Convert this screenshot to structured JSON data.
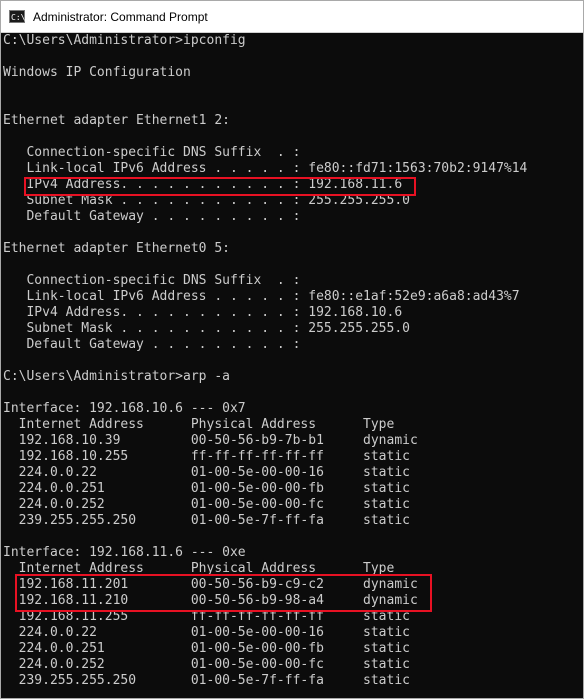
{
  "window": {
    "title": "Administrator: Command Prompt",
    "icon": "command-prompt-icon",
    "icon_glyph": "C:\\",
    "highlight_color": "#e81123"
  },
  "console": {
    "lines": [
      "C:\\Users\\Administrator>ipconfig",
      "",
      "Windows IP Configuration",
      "",
      "",
      "Ethernet adapter Ethernet1 2:",
      "",
      "   Connection-specific DNS Suffix  . :",
      "   Link-local IPv6 Address . . . . . : fe80::fd71:1563:70b2:9147%14",
      "   IPv4 Address. . . . . . . . . . . : 192.168.11.6",
      "   Subnet Mask . . . . . . . . . . . : 255.255.255.0",
      "   Default Gateway . . . . . . . . . :",
      "",
      "Ethernet adapter Ethernet0 5:",
      "",
      "   Connection-specific DNS Suffix  . :",
      "   Link-local IPv6 Address . . . . . : fe80::e1af:52e9:a6a8:ad43%7",
      "   IPv4 Address. . . . . . . . . . . : 192.168.10.6",
      "   Subnet Mask . . . . . . . . . . . : 255.255.255.0",
      "   Default Gateway . . . . . . . . . :",
      "",
      "C:\\Users\\Administrator>arp -a",
      "",
      "Interface: 192.168.10.6 --- 0x7",
      "  Internet Address      Physical Address      Type",
      "  192.168.10.39         00-50-56-b9-7b-b1     dynamic",
      "  192.168.10.255        ff-ff-ff-ff-ff-ff     static",
      "  224.0.0.22            01-00-5e-00-00-16     static",
      "  224.0.0.251           01-00-5e-00-00-fb     static",
      "  224.0.0.252           01-00-5e-00-00-fc     static",
      "  239.255.255.250       01-00-5e-7f-ff-fa     static",
      "",
      "Interface: 192.168.11.6 --- 0xe",
      "  Internet Address      Physical Address      Type",
      "  192.168.11.201        00-50-56-b9-c9-c2     dynamic",
      "  192.168.11.210        00-50-56-b9-98-a4     dynamic",
      "  192.168.11.255        ff-ff-ff-ff-ff-ff     static",
      "  224.0.0.22            01-00-5e-00-00-16     static",
      "  224.0.0.251           01-00-5e-00-00-fb     static",
      "  224.0.0.252           01-00-5e-00-00-fc     static",
      "  239.255.255.250       01-00-5e-7f-ff-fa     static"
    ]
  }
}
